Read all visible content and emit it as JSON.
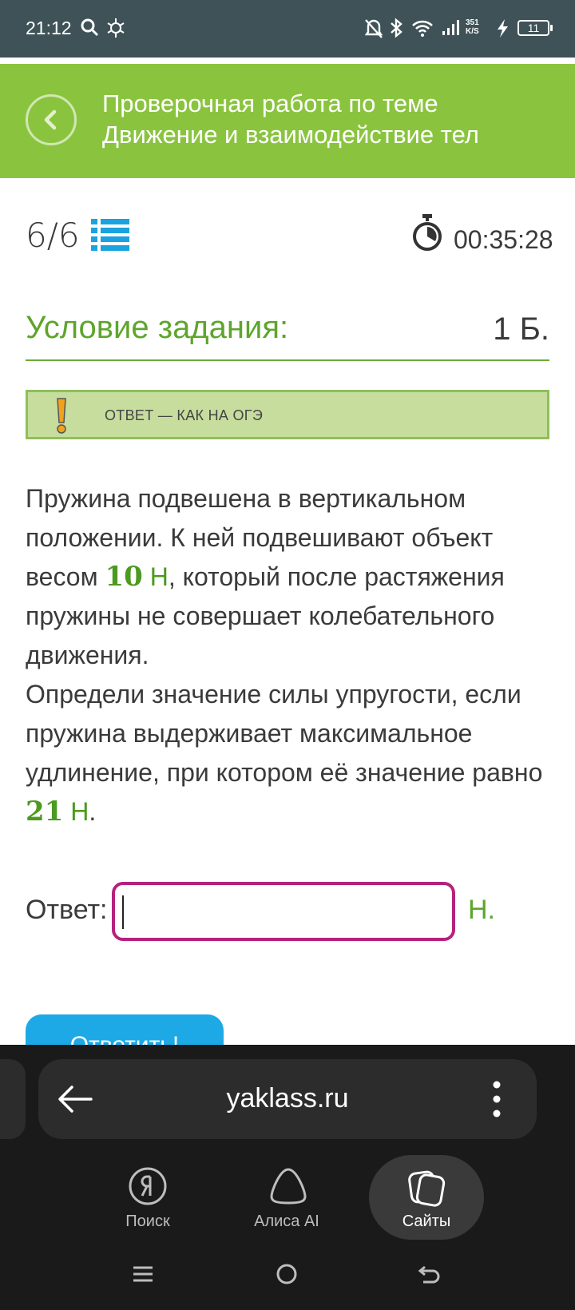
{
  "status_bar": {
    "time": "21:12",
    "net_speed_value": "351",
    "net_speed_unit": "K/S",
    "battery": "11"
  },
  "header": {
    "title_line1": "Проверочная работа по теме",
    "title_line2": "Движение и взаимодействие тел"
  },
  "progress": {
    "label": "6/6",
    "timer": "00:35:28"
  },
  "condition": {
    "title": "Условие задания:",
    "points": "1 Б."
  },
  "notice": {
    "text": "ОТВЕТ — КАК НА ОГЭ"
  },
  "question": {
    "part1": "Пружина подвешена в вертикальном положении. К ней подвешивают объект весом ",
    "value1": "10",
    "unit1": " Н",
    "part2": ", который после растяжения пружины не совершает колебательного движения.",
    "part3": "Определи значение силы упругости, если пружина выдерживает максимальное удлинение, при котором её значение равно ",
    "value2": "21",
    "unit2": " Н",
    "part4": "."
  },
  "answer": {
    "label": "Ответ:",
    "value": "",
    "unit": "Н."
  },
  "submit_label": "Ответить!",
  "browser": {
    "url": "yaklass.ru",
    "nav": [
      {
        "label": "Поиск",
        "icon": "yandex-search-icon"
      },
      {
        "label": "Алиса AI",
        "icon": "alice-icon"
      },
      {
        "label": "Сайты",
        "icon": "sites-icon",
        "active": true
      }
    ]
  },
  "colors": {
    "header_green": "#8ac43f",
    "title_green": "#5ea52c",
    "input_border": "#b5227e",
    "button_blue": "#1da9e6",
    "statusbar": "#3f5257"
  }
}
